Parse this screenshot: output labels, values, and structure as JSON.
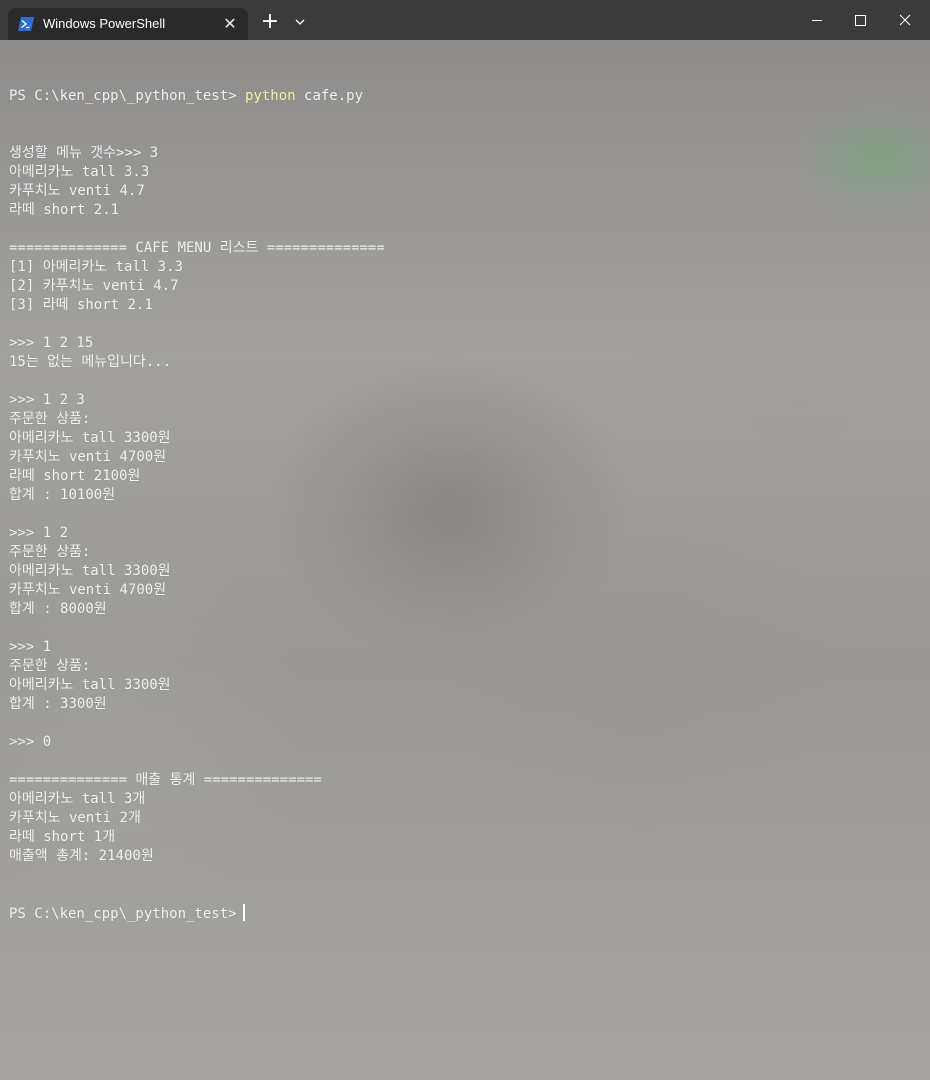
{
  "window": {
    "tab_title": "Windows PowerShell",
    "tab_icon": "powershell-icon",
    "close_tab_glyph": "✕",
    "new_tab_glyph": "+",
    "dropdown_icon": "chevron-down-icon",
    "minimize_icon": "minimize-icon",
    "maximize_icon": "maximize-icon",
    "close_icon": "close-icon",
    "colors": {
      "titlebar": "#3b3b3b",
      "tab": "#2a2a2a",
      "text": "#f2f2f2",
      "command": "#f9f1a5"
    }
  },
  "terminal": {
    "prompt": "PS C:\\ken_cpp\\_python_test> ",
    "command_program": "python",
    "command_args": " cafe.py",
    "lines": [
      "생성할 메뉴 갯수>>> 3",
      "아메리카노 tall 3.3",
      "카푸치노 venti 4.7",
      "라떼 short 2.1",
      "",
      "============== CAFE MENU 리스트 ==============",
      "[1] 아메리카노 tall 3.3",
      "[2] 카푸치노 venti 4.7",
      "[3] 라떼 short 2.1",
      "",
      ">>> 1 2 15",
      "15는 없는 메뉴입니다...",
      "",
      ">>> 1 2 3",
      "주문한 상품:",
      "아메리카노 tall 3300원",
      "카푸치노 venti 4700원",
      "라떼 short 2100원",
      "합계 : 10100원",
      "",
      ">>> 1 2",
      "주문한 상품:",
      "아메리카노 tall 3300원",
      "카푸치노 venti 4700원",
      "합계 : 8000원",
      "",
      ">>> 1",
      "주문한 상품:",
      "아메리카노 tall 3300원",
      "합계 : 3300원",
      "",
      ">>> 0",
      "",
      "============== 매출 통계 ==============",
      "아메리카노 tall 3개",
      "카푸치노 venti 2개",
      "라떼 short 1개",
      "매출액 총계: 21400원"
    ],
    "final_prompt": "PS C:\\ken_cpp\\_python_test>"
  }
}
